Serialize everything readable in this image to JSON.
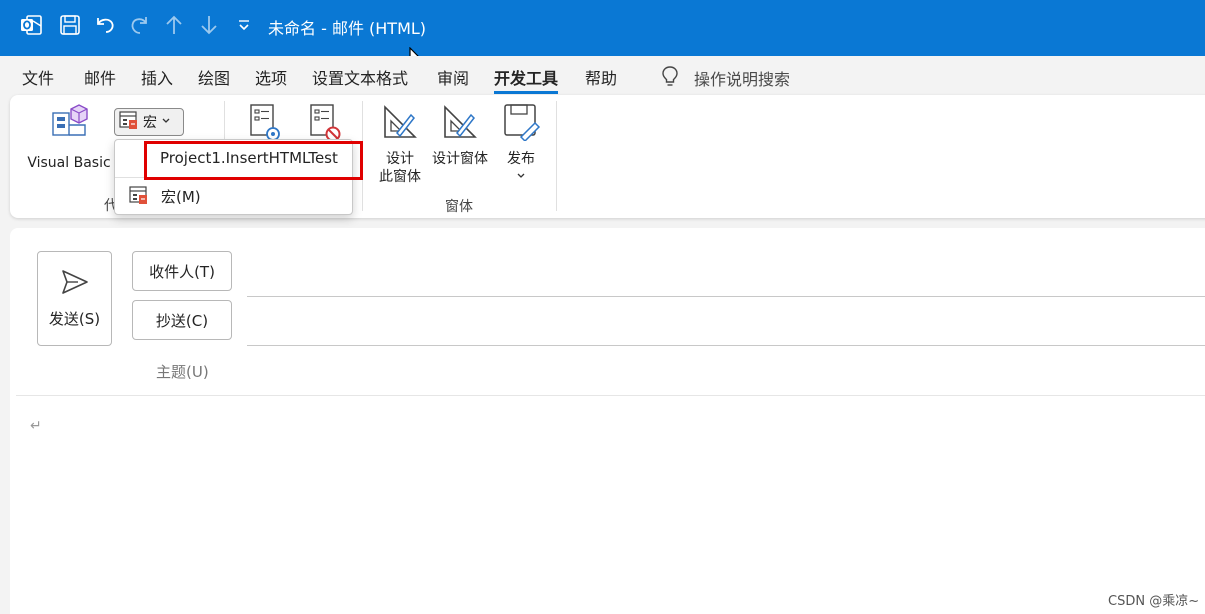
{
  "window": {
    "title": "未命名  -  邮件 (HTML)",
    "accent_color": "#0a78d4",
    "quick_access_icons": [
      "outlook-logo-icon",
      "save-icon",
      "undo-icon",
      "redo-icon",
      "arrow-up-icon",
      "arrow-down-icon",
      "customize-dropdown-icon"
    ]
  },
  "tabs": [
    {
      "label": "文件"
    },
    {
      "label": "邮件"
    },
    {
      "label": "插入"
    },
    {
      "label": "绘图"
    },
    {
      "label": "选项"
    },
    {
      "label": "设置文本格式"
    },
    {
      "label": "审阅"
    },
    {
      "label": "开发工具",
      "active": true
    },
    {
      "label": "帮助"
    }
  ],
  "tell_me": {
    "placeholder": "操作说明搜索",
    "icon": "lightbulb-icon"
  },
  "ribbon": {
    "visual_basic_label": "Visual Basic",
    "macros_label": "宏",
    "code_group_label_partial": "代",
    "design_form_label_line1": "设计",
    "design_form_label_line2": "此窗体",
    "design_a_form_label": "设计窗体",
    "publish_label": "发布",
    "forms_group_label": "窗体"
  },
  "macro_dropdown": {
    "items": [
      {
        "label": "Project1.InsertHTMLTest",
        "highlighted": true
      },
      {
        "label": "宏(M)",
        "mnemonic": "M",
        "icon": "macros-icon"
      }
    ],
    "highlight_color": "#e00000"
  },
  "compose": {
    "send_label": "发送(S)",
    "to_label": "收件人(T)",
    "cc_label": "抄送(C)",
    "subject_label": "主题(U)",
    "body_return_mark": "↵"
  },
  "watermark": "CSDN @乘凉~"
}
